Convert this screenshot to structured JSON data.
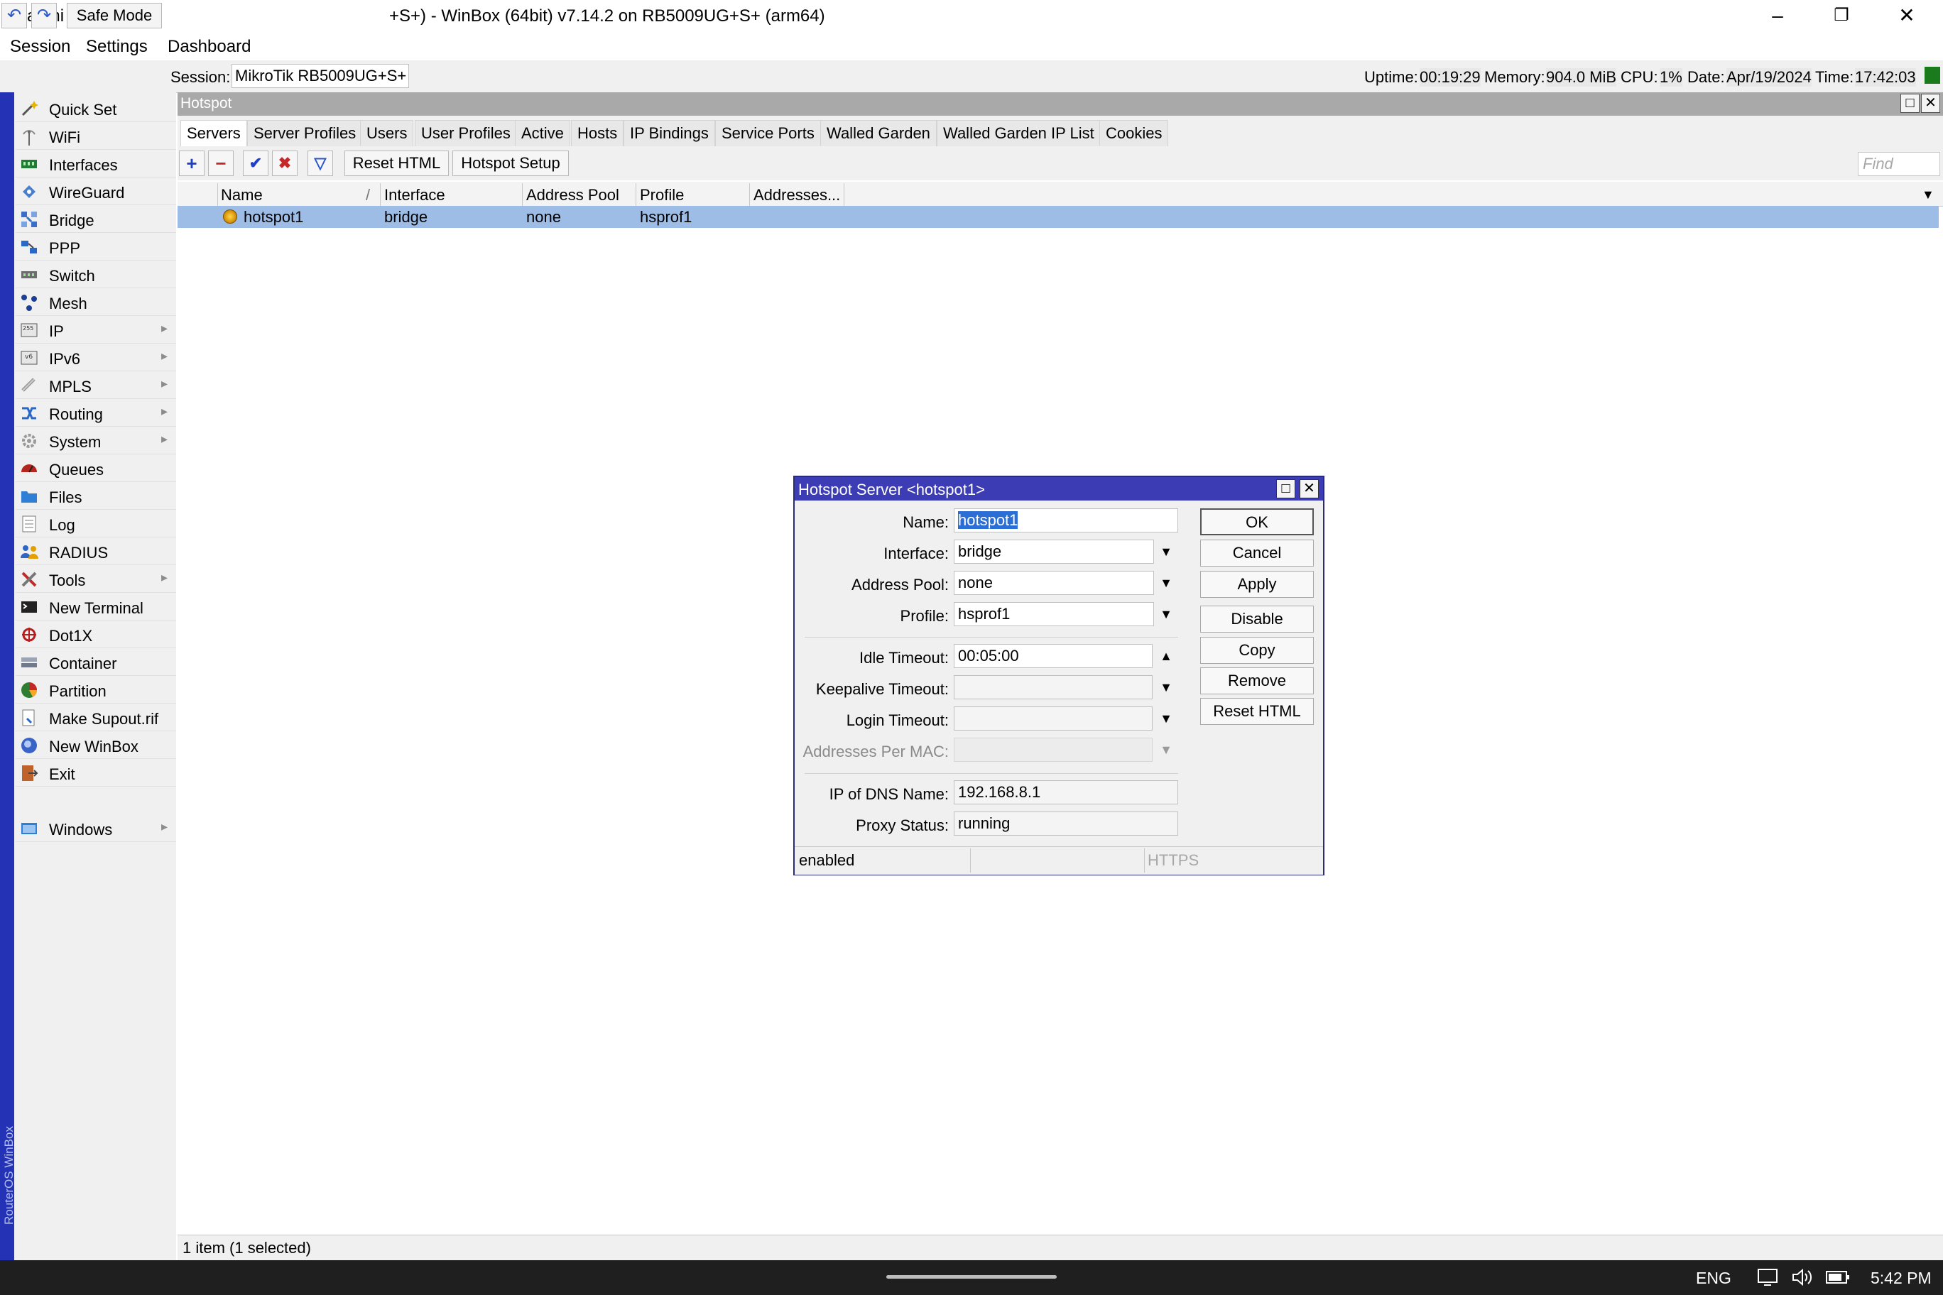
{
  "window": {
    "title_left": "admi",
    "title": "+S+) - WinBox (64bit) v7.14.2 on RB5009UG+S+ (arm64)",
    "controls": [
      "–",
      "❐",
      "✕"
    ]
  },
  "menu": [
    "Session",
    "Settings",
    "Dashboard"
  ],
  "toolbar": {
    "undo": "↶",
    "redo": "↷",
    "safe_mode": "Safe Mode",
    "session_label": "Session:",
    "session_value": "MikroTik RB5009UG+S+",
    "uptime_label": "Uptime:",
    "uptime": "00:19:29",
    "memory_label": "Memory:",
    "memory": "904.0 MiB",
    "cpu_label": "CPU:",
    "cpu": "1%",
    "date_label": "Date:",
    "date": "Apr/19/2024",
    "time_label": "Time:",
    "time": "17:42:03",
    "status_color": "#1b7a1b"
  },
  "sidebar": {
    "brand": "RouterOS WinBox",
    "items": [
      {
        "label": "Quick Set",
        "icon": "wand-icon"
      },
      {
        "label": "WiFi",
        "icon": "antenna-icon"
      },
      {
        "label": "Interfaces",
        "icon": "interfaces-icon"
      },
      {
        "label": "WireGuard",
        "icon": "wireguard-icon"
      },
      {
        "label": "Bridge",
        "icon": "bridge-icon"
      },
      {
        "label": "PPP",
        "icon": "ppp-icon"
      },
      {
        "label": "Switch",
        "icon": "switch-icon"
      },
      {
        "label": "Mesh",
        "icon": "mesh-icon"
      },
      {
        "label": "IP",
        "icon": "ip-icon",
        "submenu": true
      },
      {
        "label": "IPv6",
        "icon": "ipv6-icon",
        "submenu": true
      },
      {
        "label": "MPLS",
        "icon": "mpls-icon",
        "submenu": true
      },
      {
        "label": "Routing",
        "icon": "routing-icon",
        "submenu": true
      },
      {
        "label": "System",
        "icon": "gear-icon",
        "submenu": true
      },
      {
        "label": "Queues",
        "icon": "queues-icon"
      },
      {
        "label": "Files",
        "icon": "folder-icon"
      },
      {
        "label": "Log",
        "icon": "log-icon"
      },
      {
        "label": "RADIUS",
        "icon": "radius-icon"
      },
      {
        "label": "Tools",
        "icon": "tools-icon",
        "submenu": true
      },
      {
        "label": "New Terminal",
        "icon": "terminal-icon"
      },
      {
        "label": "Dot1X",
        "icon": "dot1x-icon"
      },
      {
        "label": "Container",
        "icon": "container-icon"
      },
      {
        "label": "Partition",
        "icon": "partition-icon"
      },
      {
        "label": "Make Supout.rif",
        "icon": "supout-icon"
      },
      {
        "label": "New WinBox",
        "icon": "winbox-icon"
      },
      {
        "label": "Exit",
        "icon": "exit-icon"
      }
    ],
    "windows": {
      "label": "Windows",
      "icon": "windows-icon",
      "submenu": true
    },
    "submenu_arrow": "▸"
  },
  "hotspot": {
    "title": "Hotspot",
    "tabs": [
      "Servers",
      "Server Profiles",
      "Users",
      "User Profiles",
      "Active",
      "Hosts",
      "IP Bindings",
      "Service Ports",
      "Walled Garden",
      "Walled Garden IP List",
      "Cookies"
    ],
    "buttons": {
      "add": "+",
      "remove": "−",
      "enable": "✔",
      "disable": "✖",
      "filter": "▽",
      "reset_html": "Reset HTML",
      "setup": "Hotspot Setup"
    },
    "find_placeholder": "Find",
    "columns": [
      "Name",
      "Interface",
      "Address Pool",
      "Profile",
      "Addresses..."
    ],
    "sort_marker": "/",
    "rows": [
      {
        "name": "hotspot1",
        "interface": "bridge",
        "address_pool": "none",
        "profile": "hsprof1",
        "addresses": ""
      }
    ],
    "status": "1 item (1 selected)",
    "col_menu": "▼"
  },
  "dialog": {
    "title": "Hotspot Server <hotspot1>",
    "fields": {
      "name_label": "Name:",
      "name": "hotspot1",
      "interface_label": "Interface:",
      "interface": "bridge",
      "pool_label": "Address Pool:",
      "pool": "none",
      "profile_label": "Profile:",
      "profile": "hsprof1",
      "idle_label": "Idle Timeout:",
      "idle": "00:05:00",
      "keepalive_label": "Keepalive Timeout:",
      "keepalive": "",
      "login_label": "Login Timeout:",
      "login": "",
      "apm_label": "Addresses Per MAC:",
      "apm": "",
      "dns_label": "IP of DNS Name:",
      "dns": "192.168.8.1",
      "proxy_label": "Proxy Status:",
      "proxy": "running"
    },
    "buttons": [
      "OK",
      "Cancel",
      "Apply",
      "Disable",
      "Copy",
      "Remove",
      "Reset HTML"
    ],
    "status_left": "enabled",
    "status_right": "HTTPS",
    "dropdown_glyph": "▼",
    "up_glyph": "▲"
  },
  "taskbar": {
    "lang": "ENG",
    "clock": "5:42 PM"
  }
}
